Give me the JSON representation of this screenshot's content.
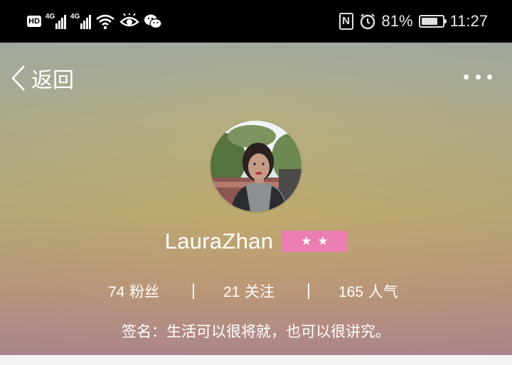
{
  "status_bar": {
    "hd_badge": "HD",
    "sim1_network": "4G",
    "sim2_network": "4G",
    "icons": [
      "signal-icon",
      "wifi-icon",
      "eye-icon",
      "wechat-icon",
      "nfc-icon",
      "alarm-icon",
      "battery-icon"
    ],
    "nfc_letter": "N",
    "battery_percent_text": "81%",
    "battery_level": 0.81,
    "time": "11:27"
  },
  "nav": {
    "back_label": "返回",
    "back_icon": "chevron-left-icon",
    "more_icon": "more-dots-icon"
  },
  "profile": {
    "avatar_icon": "avatar-photo",
    "username": "LauraZhan",
    "level_stars": 2,
    "level_badge_color": "#ea7eb0",
    "stats": [
      {
        "value": "74",
        "label": "粉丝"
      },
      {
        "value": "21",
        "label": "关注"
      },
      {
        "value": "165",
        "label": "人气"
      }
    ],
    "signature": "签名：生活可以很将就，也可以很讲究。"
  }
}
